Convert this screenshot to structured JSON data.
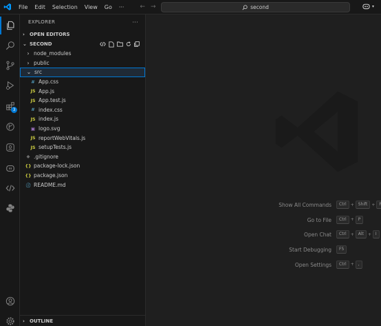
{
  "titlebar": {
    "menu": [
      "File",
      "Edit",
      "Selection",
      "View",
      "Go",
      "···"
    ],
    "search_text": "second"
  },
  "activity": {
    "extensions_badge": "3"
  },
  "sidebar": {
    "title": "EXPLORER",
    "more": "···",
    "open_editors": "OPEN EDITORS",
    "project": "SECOND",
    "outline": "OUTLINE"
  },
  "tree": [
    {
      "label": "node_modules",
      "type": "folder",
      "expanded": false,
      "depth": 1
    },
    {
      "label": "public",
      "type": "folder",
      "expanded": false,
      "depth": 1
    },
    {
      "label": "src",
      "type": "folder",
      "expanded": true,
      "depth": 1,
      "selected": true
    },
    {
      "label": "App.css",
      "type": "css",
      "depth": 2
    },
    {
      "label": "App.js",
      "type": "js",
      "depth": 2
    },
    {
      "label": "App.test.js",
      "type": "js",
      "depth": 2
    },
    {
      "label": "index.css",
      "type": "css",
      "depth": 2
    },
    {
      "label": "index.js",
      "type": "js",
      "depth": 2
    },
    {
      "label": "logo.svg",
      "type": "svg",
      "depth": 2
    },
    {
      "label": "reportWebVitals.js",
      "type": "js",
      "depth": 2
    },
    {
      "label": "setupTests.js",
      "type": "js",
      "depth": 2
    },
    {
      "label": ".gitignore",
      "type": "git",
      "depth": 1
    },
    {
      "label": "package-lock.json",
      "type": "json",
      "depth": 1
    },
    {
      "label": "package.json",
      "type": "json",
      "depth": 1
    },
    {
      "label": "README.md",
      "type": "info",
      "depth": 1
    }
  ],
  "icons": {
    "css": "#",
    "js": "JS",
    "svg": "▣",
    "json": "{}",
    "info": "ⓘ",
    "git": "◆"
  },
  "shortcuts": [
    {
      "label": "Show All Commands",
      "keys": [
        "Ctrl",
        "Shift",
        "P"
      ]
    },
    {
      "label": "Go to File",
      "keys": [
        "Ctrl",
        "P"
      ]
    },
    {
      "label": "Open Chat",
      "keys": [
        "Ctrl",
        "Alt",
        "I"
      ]
    },
    {
      "label": "Start Debugging",
      "keys": [
        "F5"
      ]
    },
    {
      "label": "Open Settings",
      "keys": [
        "Ctrl",
        ","
      ]
    }
  ],
  "colors": {
    "accent": "#0078d4",
    "background": "#1f1f1f",
    "sidebar": "#181818"
  }
}
